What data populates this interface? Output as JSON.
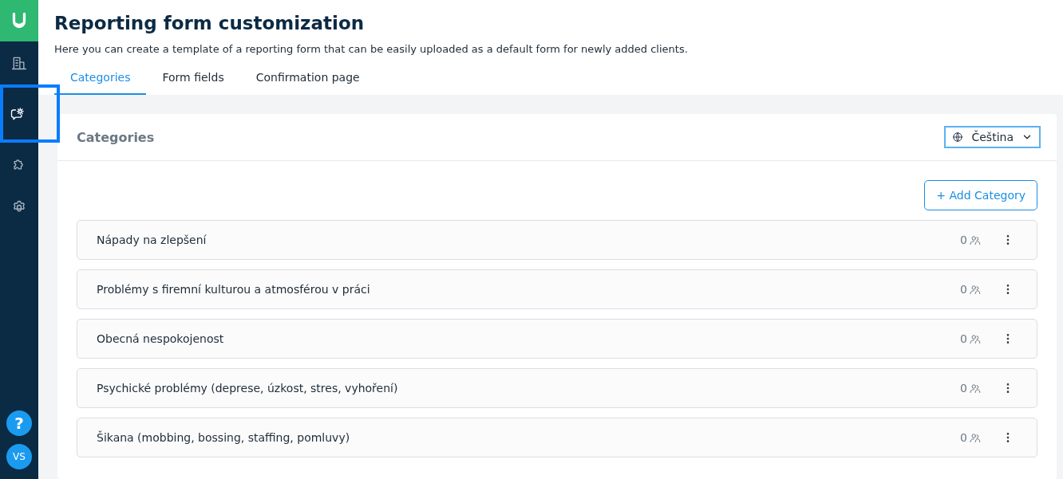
{
  "sidebar": {
    "items": [
      {
        "kind": "building",
        "selected": false
      },
      {
        "kind": "chat-gear",
        "selected": true
      },
      {
        "kind": "puzzle",
        "selected": false
      },
      {
        "kind": "gear",
        "selected": false
      }
    ],
    "help": "?",
    "avatar": "VS"
  },
  "header": {
    "title": "Reporting form customization",
    "subtitle": "Here you can create a template of a reporting form that can be easily uploaded as a default form for newly added clients."
  },
  "tabs": [
    {
      "label": "Categories",
      "selected": true
    },
    {
      "label": "Form fields",
      "selected": false
    },
    {
      "label": "Confirmation page",
      "selected": false
    }
  ],
  "card": {
    "title": "Categories",
    "language": "Čeština",
    "add_button": "+ Add Category",
    "categories": [
      {
        "name": "Nápady na zlepšení",
        "count": "0"
      },
      {
        "name": "Problémy s firemní kulturou a atmosférou v práci",
        "count": "0"
      },
      {
        "name": "Obecná nespokojenost",
        "count": "0"
      },
      {
        "name": "Psychické problémy (deprese, úzkost, stres, vyhoření)",
        "count": "0"
      },
      {
        "name": "Šikana (mobbing, bossing, staffing, pomluvy)",
        "count": "0"
      }
    ]
  }
}
